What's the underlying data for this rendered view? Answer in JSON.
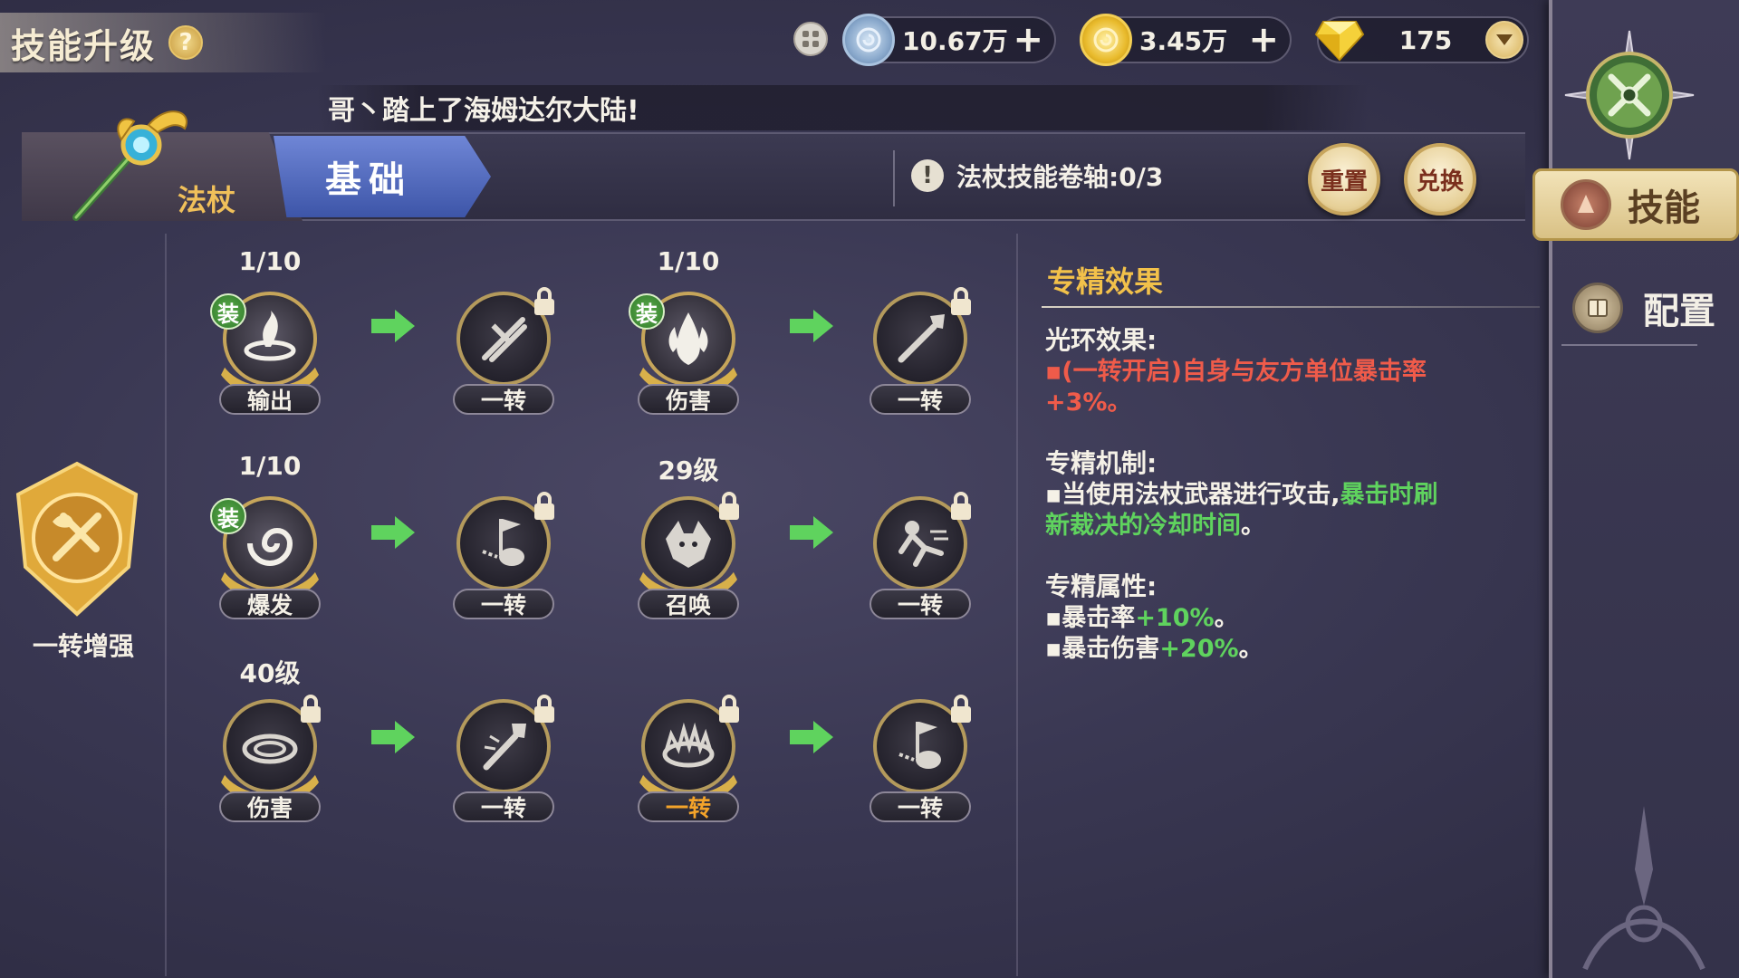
{
  "header": {
    "title": "技能升级",
    "help_icon": "?"
  },
  "currency": [
    {
      "name": "silver-coin",
      "value": "10.67万",
      "plus": "+"
    },
    {
      "name": "gold-coin",
      "value": "3.45万",
      "plus": "+"
    },
    {
      "name": "diamond",
      "value": "175"
    }
  ],
  "marquee": {
    "text": "哥丶踏上了海姆达尔大陆!"
  },
  "weapon": {
    "label": "法杖",
    "tab_label": "基础"
  },
  "scroll_info": {
    "text": "法杖技能卷轴:0/3"
  },
  "buttons": {
    "reset": "重置",
    "exchange": "兑换"
  },
  "sidebar": {
    "skill_tab": "技能",
    "config_tab": "配置"
  },
  "enhance": {
    "label": "一转增强"
  },
  "skill_rows": [
    {
      "nodes": [
        {
          "top": "1/10",
          "tag": "输出",
          "equipped": "装",
          "locked": false
        },
        {
          "top": "",
          "tag": "一转",
          "locked": true
        },
        {
          "top": "1/10",
          "tag": "伤害",
          "equipped": "装",
          "locked": false
        },
        {
          "top": "",
          "tag": "一转",
          "locked": true
        }
      ]
    },
    {
      "nodes": [
        {
          "top": "1/10",
          "tag": "爆发",
          "equipped": "装",
          "locked": false
        },
        {
          "top": "",
          "tag": "一转",
          "locked": true
        },
        {
          "top": "29级",
          "tag": "召唤",
          "locked": true
        },
        {
          "top": "",
          "tag": "一转",
          "locked": true
        }
      ]
    },
    {
      "nodes": [
        {
          "top": "40级",
          "tag": "伤害",
          "locked": true
        },
        {
          "top": "",
          "tag": "一转",
          "locked": true
        },
        {
          "top": "",
          "tag": "一转",
          "locked": true,
          "highlight": true
        },
        {
          "top": "",
          "tag": "一转",
          "locked": true
        }
      ]
    }
  ],
  "description": {
    "title": "专精效果",
    "aura_head": "光环效果:",
    "aura_line1": "▪(一转开启)自身与友方单位暴击率",
    "aura_line2": "+3%。",
    "mech_head": "专精机制:",
    "mech_prefix": "▪当使用法杖武器进行攻击,",
    "mech_green1": "暴击时刷",
    "mech_green2": "新裁决的冷却时间",
    "mech_suffix": "。",
    "attr_head": "专精属性:",
    "attr1_label": "▪暴击率",
    "attr1_value": "+10%",
    "attr1_suffix": "。",
    "attr2_label": "▪暴击伤害",
    "attr2_value": "+20%",
    "attr2_suffix": "。"
  },
  "colors": {
    "gold": "#f2c14a",
    "red": "#ef5b4a",
    "green": "#5fd35e",
    "tab_blue": "#4d66bd"
  }
}
